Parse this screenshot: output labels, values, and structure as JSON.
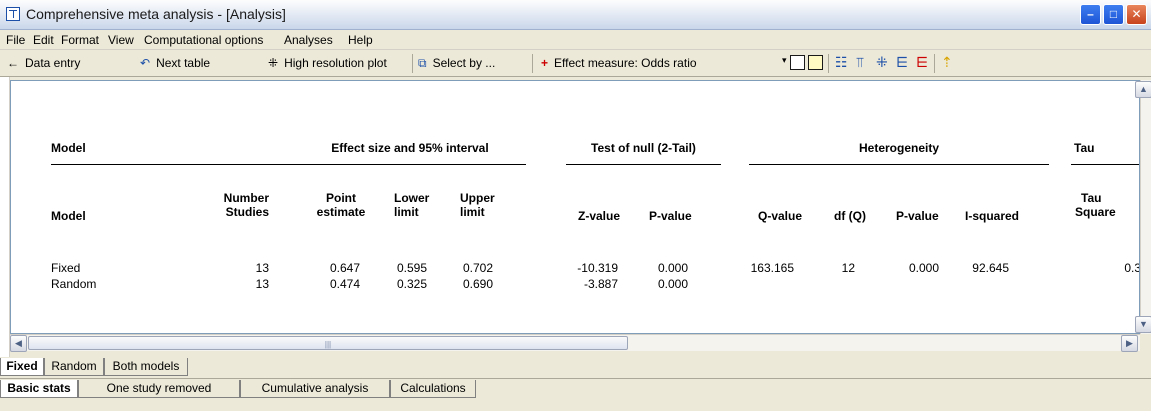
{
  "window": {
    "title": "Comprehensive meta analysis - [Analysis]",
    "minimize": "–",
    "maximize": "□",
    "close": "✕"
  },
  "menu": [
    "File",
    "Edit",
    "Format",
    "View",
    "Computational options",
    "Analyses",
    "Help"
  ],
  "toolbar": {
    "data_entry": "Data entry",
    "next_table": "Next table",
    "high_res_plot": "High resolution plot",
    "select_by": "Select by ...",
    "effect_measure": "Effect measure: Odds ratio"
  },
  "table": {
    "group_headers": {
      "model": "Model",
      "effect": "Effect size and 95% interval",
      "null": "Test of null (2-Tail)",
      "heterogeneity": "Heterogeneity",
      "tau": "Tau"
    },
    "columns": {
      "model": "Model",
      "n_studies": [
        "Number",
        "Studies"
      ],
      "point": [
        "Point",
        "estimate"
      ],
      "lower": [
        "Lower",
        "limit"
      ],
      "upper": [
        "Upper",
        "limit"
      ],
      "z": "Z-value",
      "p": "P-value",
      "q": "Q-value",
      "dfq": "df (Q)",
      "p_het": "P-value",
      "isq": "I-squared",
      "tau_sq": [
        "Tau",
        "Square"
      ]
    },
    "rows": [
      {
        "model": "Fixed",
        "n": "13",
        "point": "0.647",
        "lower": "0.595",
        "upper": "0.702",
        "z": "-10.319",
        "p": "0.000",
        "q": "163.165",
        "dfq": "12",
        "p_het": "0.000",
        "isq": "92.645",
        "tau_sq": "0.3"
      },
      {
        "model": "Random",
        "n": "13",
        "point": "0.474",
        "lower": "0.325",
        "upper": "0.690",
        "z": "-3.887",
        "p": "0.000",
        "q": "",
        "dfq": "",
        "p_het": "",
        "isq": "",
        "tau_sq": ""
      }
    ]
  },
  "model_tabs": [
    "Fixed",
    "Random",
    "Both models"
  ],
  "view_tabs": [
    "Basic stats",
    "One study removed",
    "Cumulative analysis",
    "Calculations"
  ]
}
